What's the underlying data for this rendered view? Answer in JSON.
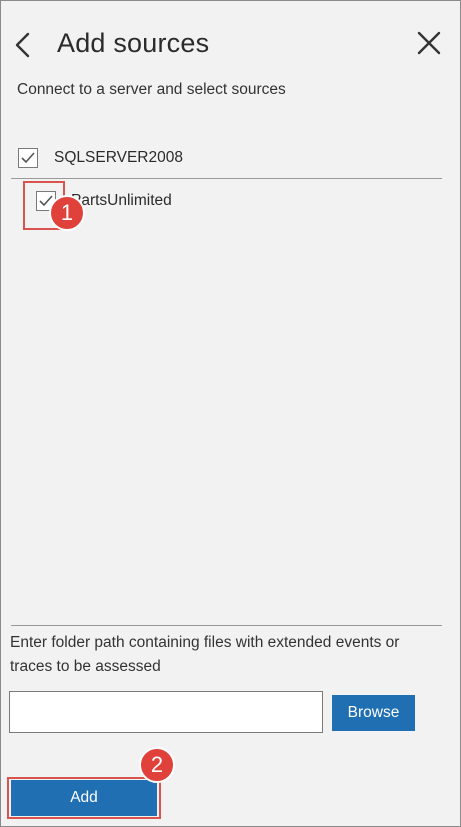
{
  "header": {
    "title": "Add sources",
    "back_icon": "chevron-left-icon",
    "close_icon": "close-icon"
  },
  "subtitle": "Connect to a server and select sources",
  "tree": {
    "server": {
      "label": "SQLSERVER2008",
      "checked": true
    },
    "databases": [
      {
        "label": "PartsUnlimited",
        "checked": true
      }
    ]
  },
  "extended_events": {
    "hint": "Enter folder path containing files with extended events or traces to be assessed",
    "path_value": "",
    "browse_label": "Browse"
  },
  "footer": {
    "add_label": "Add"
  },
  "annotations": {
    "step1": "1",
    "step2": "2"
  },
  "colors": {
    "accent": "#1f6fb2",
    "callout": "#e0413a",
    "panel_bg": "#f2f2f2"
  }
}
